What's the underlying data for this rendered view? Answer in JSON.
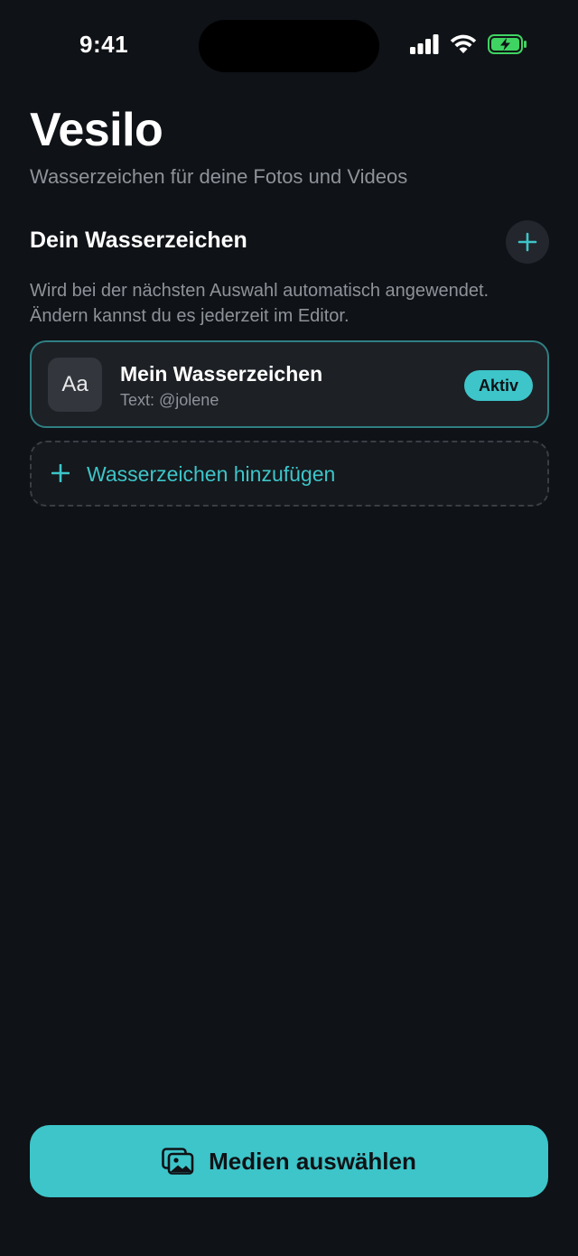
{
  "status_bar": {
    "time": "9:41"
  },
  "header": {
    "title": "Vesilo",
    "subtitle": "Wasserzeichen für deine Fotos und Videos"
  },
  "section": {
    "title": "Dein Wasserzeichen",
    "description_line1": "Wird bei der nächsten Auswahl automatisch angewendet.",
    "description_line2": "Ändern kannst du es jederzeit im Editor.",
    "add_icon": "plus-icon"
  },
  "watermarks": [
    {
      "thumb_text": "Aa",
      "name": "Mein Wasserzeichen",
      "detail": "Text: @jolene",
      "badge": "Aktiv"
    }
  ],
  "add_watermark": {
    "label": "Wasserzeichen hinzufügen",
    "icon": "plus-icon"
  },
  "cta": {
    "label": "Medien auswählen",
    "icon": "photos-icon"
  },
  "colors": {
    "background": "#0f1216",
    "accent": "#3dc5c9",
    "card": "#1d2025",
    "card_border": "#2f7f83",
    "muted_text": "#8e939a",
    "battery": "#3fd462"
  }
}
